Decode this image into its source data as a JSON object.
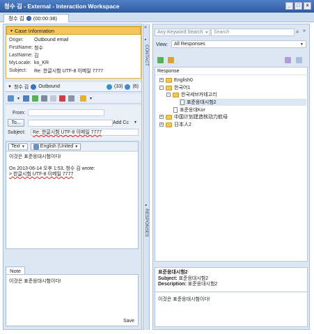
{
  "window": {
    "title": "청수 김 - External - Interaction Workspace",
    "buttons": [
      "_",
      "□",
      "×"
    ]
  },
  "tab": {
    "label": "청수 김",
    "time": "(00:00:38)"
  },
  "case_info": {
    "header": "Case Information",
    "rows": [
      {
        "key": "Origin:",
        "value": "Outbound email"
      },
      {
        "key": "FirstName:",
        "value": "청수"
      },
      {
        "key": "LastName:",
        "value": "김"
      },
      {
        "key": "MyLocale:",
        "value": "ko_KR"
      },
      {
        "key": "Subject:",
        "value": "Re: 한글시험 UTF-8 이메일 7777"
      }
    ]
  },
  "agent_bar": {
    "name": "청수 김",
    "mode": "Outbound",
    "count1": "(33)",
    "count2": "(6)"
  },
  "email": {
    "from_label": "From:",
    "to_button": "To...",
    "add_cc": "Add Cc",
    "subject_label": "Subject:",
    "subject_value": "Re: 한글시험 UTF-8 이메일 7777"
  },
  "composer": {
    "format": "Text",
    "language": "English (United",
    "lines": [
      "이것은 표준응대시험이다!",
      "",
      "On 2013-06-14 오후 1:53, 청수 김 wrote:",
      "> 한글시험 UTF-8 이메일 7777"
    ]
  },
  "note": {
    "tab": "Note",
    "text": "이것은 표준응대시험이다!",
    "save": "Save"
  },
  "side_labels": {
    "contact": "CONTACT",
    "responses": "RESPONSES"
  },
  "responses": {
    "search_scope": "Any Keyword Search",
    "search_placeholder": "Search",
    "view_label": "View:",
    "view_value": "All Responses",
    "column": "Response",
    "tree": [
      {
        "label": "English0",
        "level": 0,
        "kind": "folder",
        "exp": "+"
      },
      {
        "label": "한국어1",
        "level": 0,
        "kind": "folder",
        "exp": "-"
      },
      {
        "label": "한국세브카테고리",
        "level": 1,
        "kind": "folder",
        "exp": "-"
      },
      {
        "label": "표준응대시험2",
        "level": 2,
        "kind": "doc",
        "exp": ""
      },
      {
        "label": "표준응대Kor",
        "level": 1,
        "kind": "doc",
        "exp": ""
      },
      {
        "label": "中国计划建造核动力航母",
        "level": 0,
        "kind": "folder",
        "exp": "+"
      },
      {
        "label": "日本人2",
        "level": 0,
        "kind": "folder",
        "exp": "+"
      }
    ]
  },
  "preview": {
    "title": "표준응대시험2",
    "subject_label": "Subject:",
    "subject": "표준응대시험2",
    "description_label": "Description:",
    "description": "표준응대시험2",
    "body": "이것은 표준응대시험이다!"
  },
  "colors": {
    "title_bar": "#3a6bb5",
    "case_header": "#f5c45a",
    "pane_bg": "#dde7f3"
  }
}
